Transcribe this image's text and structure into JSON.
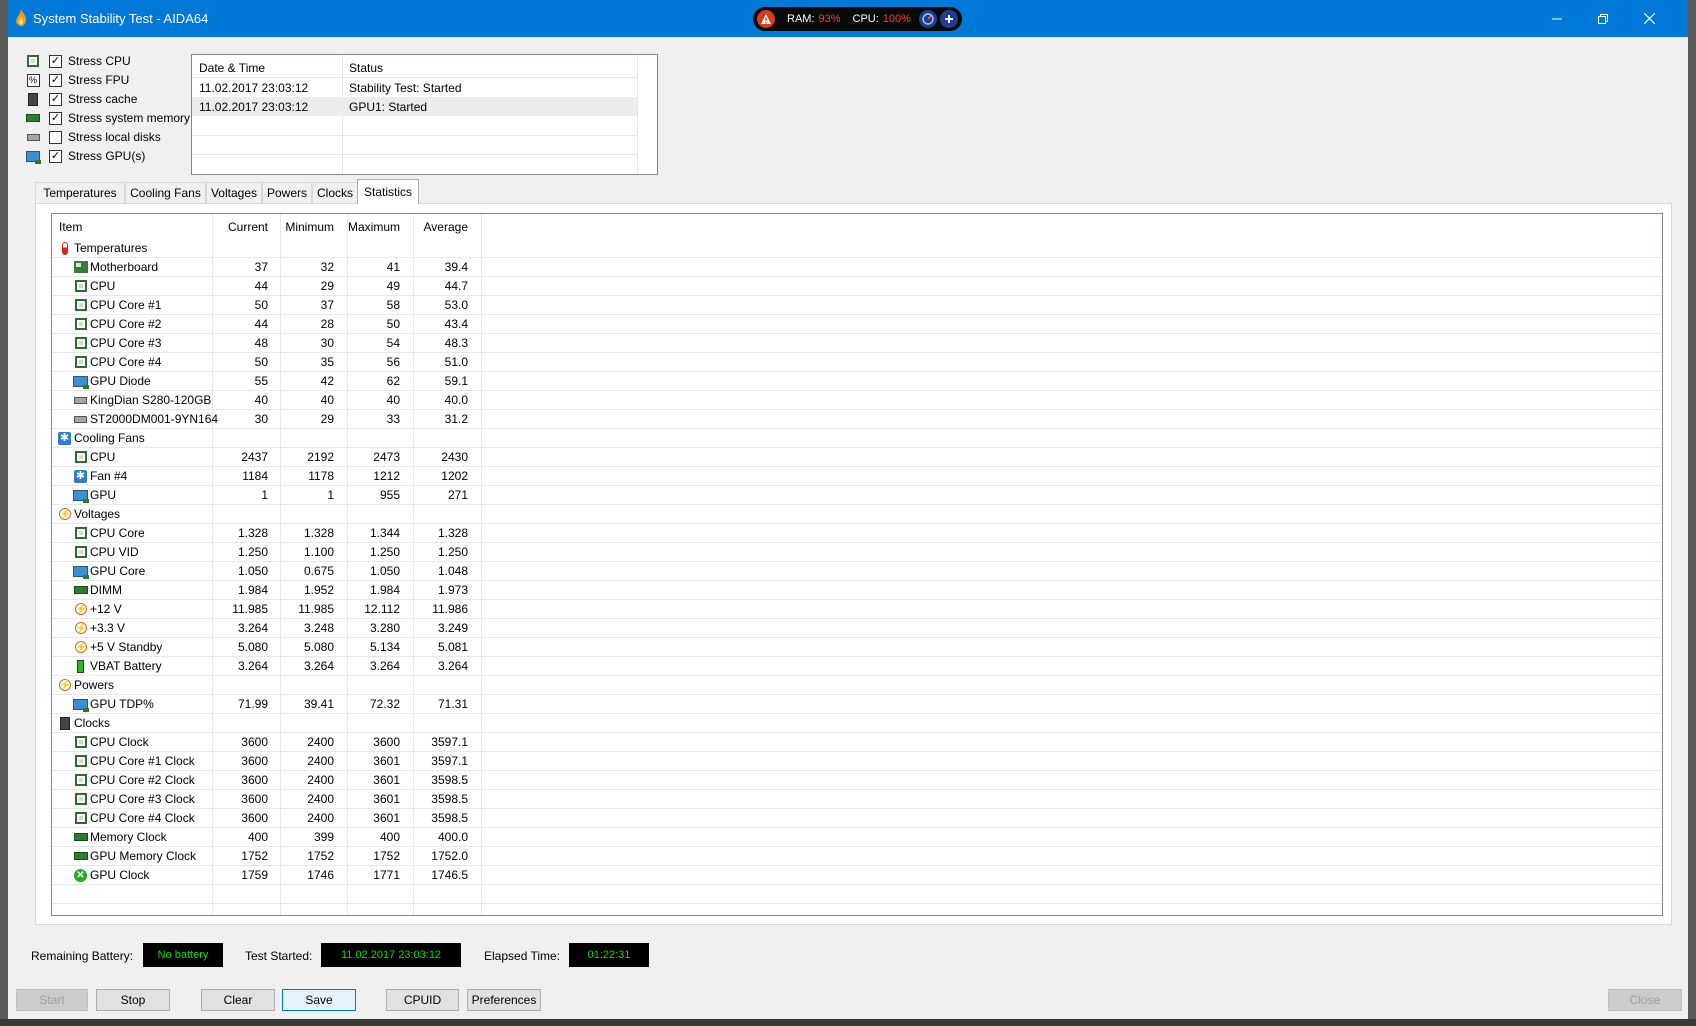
{
  "window": {
    "title": "System Stability Test - AIDA64"
  },
  "overlay": {
    "ram_label": "RAM:",
    "ram_value": "93%",
    "cpu_label": "CPU:",
    "cpu_value": "100%"
  },
  "stress_options": [
    {
      "label": "Stress CPU",
      "checked": true,
      "icon": "cpu-chip-icon"
    },
    {
      "label": "Stress FPU",
      "checked": true,
      "icon": "fpu-icon"
    },
    {
      "label": "Stress cache",
      "checked": true,
      "icon": "cache-icon"
    },
    {
      "label": "Stress system memory",
      "checked": true,
      "icon": "memory-icon"
    },
    {
      "label": "Stress local disks",
      "checked": false,
      "icon": "disk-icon"
    },
    {
      "label": "Stress GPU(s)",
      "checked": true,
      "icon": "gpu-icon"
    }
  ],
  "log": {
    "headers": [
      "Date & Time",
      "Status"
    ],
    "rows": [
      {
        "datetime": "11.02.2017 23:03:12",
        "status": "Stability Test: Started"
      },
      {
        "datetime": "11.02.2017 23:03:12",
        "status": "GPU1: Started"
      }
    ]
  },
  "tabs": [
    "Temperatures",
    "Cooling Fans",
    "Voltages",
    "Powers",
    "Clocks",
    "Statistics"
  ],
  "active_tab": "Statistics",
  "grid": {
    "headers": [
      "Item",
      "Current",
      "Minimum",
      "Maximum",
      "Average"
    ],
    "rows": [
      {
        "group": true,
        "icon": "thermometer-icon",
        "name": "Temperatures"
      },
      {
        "icon": "motherboard-icon",
        "name": "Motherboard",
        "cur": "37",
        "min": "32",
        "max": "41",
        "avg": "39.4"
      },
      {
        "icon": "cpu-chip-icon",
        "name": "CPU",
        "cur": "44",
        "min": "29",
        "max": "49",
        "avg": "44.7"
      },
      {
        "icon": "cpu-chip-icon",
        "name": "CPU Core #1",
        "cur": "50",
        "min": "37",
        "max": "58",
        "avg": "53.0"
      },
      {
        "icon": "cpu-chip-icon",
        "name": "CPU Core #2",
        "cur": "44",
        "min": "28",
        "max": "50",
        "avg": "43.4"
      },
      {
        "icon": "cpu-chip-icon",
        "name": "CPU Core #3",
        "cur": "48",
        "min": "30",
        "max": "54",
        "avg": "48.3"
      },
      {
        "icon": "cpu-chip-icon",
        "name": "CPU Core #4",
        "cur": "50",
        "min": "35",
        "max": "56",
        "avg": "51.0"
      },
      {
        "icon": "gpu-icon",
        "name": "GPU Diode",
        "cur": "55",
        "min": "42",
        "max": "62",
        "avg": "59.1"
      },
      {
        "icon": "disk-icon",
        "name": "KingDian S280-120GB",
        "cur": "40",
        "min": "40",
        "max": "40",
        "avg": "40.0"
      },
      {
        "icon": "disk-icon",
        "name": "ST2000DM001-9YN164",
        "cur": "30",
        "min": "29",
        "max": "33",
        "avg": "31.2"
      },
      {
        "group": true,
        "icon": "fan-icon",
        "name": "Cooling Fans"
      },
      {
        "icon": "cpu-chip-icon",
        "name": "CPU",
        "cur": "2437",
        "min": "2192",
        "max": "2473",
        "avg": "2430"
      },
      {
        "icon": "fan-icon",
        "name": "Fan #4",
        "cur": "1184",
        "min": "1178",
        "max": "1212",
        "avg": "1202"
      },
      {
        "icon": "gpu-icon",
        "name": "GPU",
        "cur": "1",
        "min": "1",
        "max": "955",
        "avg": "271"
      },
      {
        "group": true,
        "icon": "voltage-icon",
        "name": "Voltages"
      },
      {
        "icon": "cpu-chip-icon",
        "name": "CPU Core",
        "cur": "1.328",
        "min": "1.328",
        "max": "1.344",
        "avg": "1.328"
      },
      {
        "icon": "cpu-chip-icon",
        "name": "CPU VID",
        "cur": "1.250",
        "min": "1.100",
        "max": "1.250",
        "avg": "1.250"
      },
      {
        "icon": "gpu-icon",
        "name": "GPU Core",
        "cur": "1.050",
        "min": "0.675",
        "max": "1.050",
        "avg": "1.048"
      },
      {
        "icon": "memory-icon",
        "name": "DIMM",
        "cur": "1.984",
        "min": "1.952",
        "max": "1.984",
        "avg": "1.973"
      },
      {
        "icon": "voltage-icon",
        "name": "+12 V",
        "cur": "11.985",
        "min": "11.985",
        "max": "12.112",
        "avg": "11.986"
      },
      {
        "icon": "voltage-icon",
        "name": "+3.3 V",
        "cur": "3.264",
        "min": "3.248",
        "max": "3.280",
        "avg": "3.249"
      },
      {
        "icon": "voltage-icon",
        "name": "+5 V Standby",
        "cur": "5.080",
        "min": "5.080",
        "max": "5.134",
        "avg": "5.081"
      },
      {
        "icon": "battery-icon",
        "name": "VBAT Battery",
        "cur": "3.264",
        "min": "3.264",
        "max": "3.264",
        "avg": "3.264"
      },
      {
        "group": true,
        "icon": "voltage-icon",
        "name": "Powers"
      },
      {
        "icon": "gpu-icon",
        "name": "GPU TDP%",
        "cur": "71.99",
        "min": "39.41",
        "max": "72.32",
        "avg": "71.31"
      },
      {
        "group": true,
        "icon": "clock-icon",
        "name": "Clocks"
      },
      {
        "icon": "cpu-chip-icon",
        "name": "CPU Clock",
        "cur": "3600",
        "min": "2400",
        "max": "3600",
        "avg": "3597.1"
      },
      {
        "icon": "cpu-chip-icon",
        "name": "CPU Core #1 Clock",
        "cur": "3600",
        "min": "2400",
        "max": "3601",
        "avg": "3597.1"
      },
      {
        "icon": "cpu-chip-icon",
        "name": "CPU Core #2 Clock",
        "cur": "3600",
        "min": "2400",
        "max": "3601",
        "avg": "3598.5"
      },
      {
        "icon": "cpu-chip-icon",
        "name": "CPU Core #3 Clock",
        "cur": "3600",
        "min": "2400",
        "max": "3601",
        "avg": "3598.5"
      },
      {
        "icon": "cpu-chip-icon",
        "name": "CPU Core #4 Clock",
        "cur": "3600",
        "min": "2400",
        "max": "3601",
        "avg": "3598.5"
      },
      {
        "icon": "memory-icon",
        "name": "Memory Clock",
        "cur": "400",
        "min": "399",
        "max": "400",
        "avg": "400.0"
      },
      {
        "icon": "memory-icon",
        "name": "GPU Memory Clock",
        "cur": "1752",
        "min": "1752",
        "max": "1752",
        "avg": "1752.0"
      },
      {
        "icon": "xbox-icon",
        "name": "GPU Clock",
        "cur": "1759",
        "min": "1746",
        "max": "1771",
        "avg": "1746.5"
      }
    ]
  },
  "status": {
    "battery_label": "Remaining Battery:",
    "battery_value": "No battery",
    "started_label": "Test Started:",
    "started_value": "11.02.2017 23:03:12",
    "elapsed_label": "Elapsed Time:",
    "elapsed_value": "01:22:31"
  },
  "buttons": {
    "start": "Start",
    "stop": "Stop",
    "clear": "Clear",
    "save": "Save",
    "cpuid": "CPUID",
    "preferences": "Preferences",
    "close": "Close"
  },
  "colors": {
    "titlebar": "#0078d7",
    "status_green": "#00e000",
    "overlay_red": "#ff3b2f"
  }
}
